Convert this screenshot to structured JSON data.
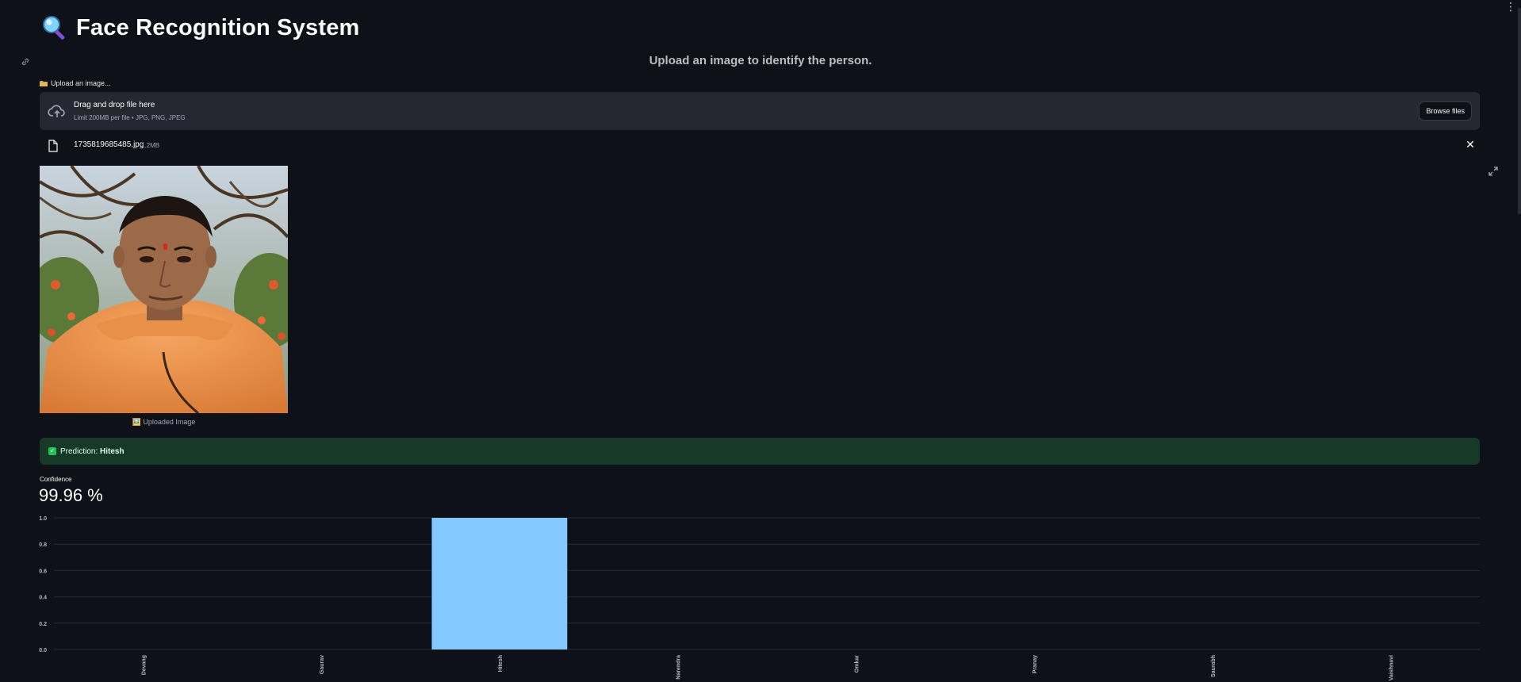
{
  "header": {
    "title": "Face Recognition System",
    "title_icon": "magnifier-icon"
  },
  "subtitle": "Upload an image to identify the person.",
  "uploader": {
    "label": "Upload an image...",
    "label_icon": "folder-icon",
    "drop_text": "Drag and drop file here",
    "limit_text": "Limit 200MB per file • JPG, PNG, JPEG",
    "browse_label": "Browse files"
  },
  "file": {
    "name": "1735819685485.jpg",
    "size": "1.2MB"
  },
  "image": {
    "caption": "Uploaded Image",
    "caption_icon": "picture-icon"
  },
  "prediction": {
    "prefix": "Prediction: ",
    "name": "Hitesh",
    "color": "#21c354"
  },
  "metric": {
    "label": "Confidence",
    "value": "99.96 %"
  },
  "colors": {
    "background": "#0e1117",
    "bar": "#83c9ff",
    "alert_bg": "#173928"
  },
  "chart_data": {
    "type": "bar",
    "categories": [
      "Devang",
      "Gaurav",
      "Hitesh",
      "Narendra",
      "Omkar",
      "Pranay",
      "Saurabh",
      "Vaishnavi"
    ],
    "values": [
      0,
      0,
      1.0,
      0,
      0,
      0,
      0,
      0
    ],
    "ylim": [
      0,
      1.0
    ],
    "yticks": [
      "0.0",
      "0.2",
      "0.4",
      "0.6",
      "0.8",
      "1.0"
    ],
    "grid": true,
    "title": "",
    "xlabel": "",
    "ylabel": ""
  }
}
